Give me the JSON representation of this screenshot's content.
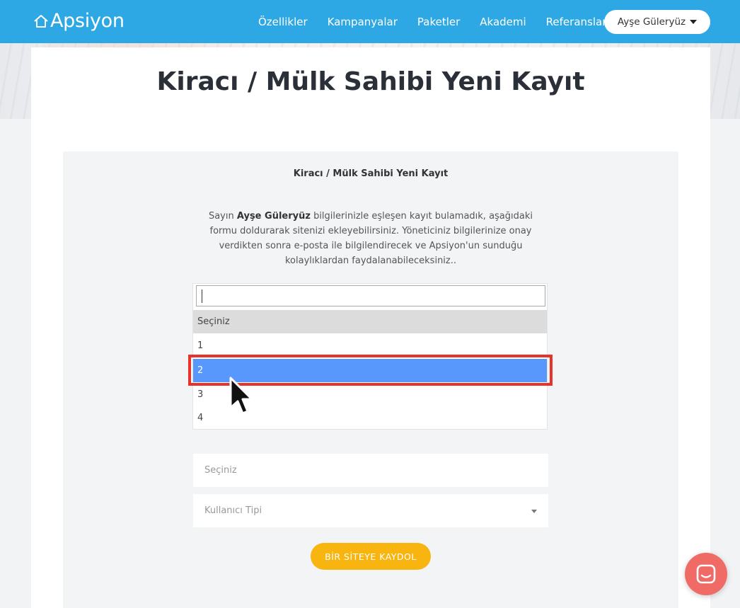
{
  "brand": {
    "name": "Apsiyon"
  },
  "nav": {
    "links": [
      "Özellikler",
      "Kampanyalar",
      "Paketler",
      "Akademi",
      "Referanslar"
    ],
    "user_name": "Ayşe Güleryüz"
  },
  "page": {
    "title": "Kiracı / Mülk Sahibi Yeni Kayıt"
  },
  "form": {
    "heading": "Kiracı / Mülk Sahibi Yeni Kayıt",
    "intro_prefix": "Sayın ",
    "intro_name": "Ayşe Güleryüz",
    "intro_suffix": " bilgilerinizle eşleşen kayıt bulamadık, aşağıdaki formu doldurarak sitenizi ekleyebilirsiniz. Yöneticiniz bilgilerinize onay verdikten sonra e-posta ile bilgilendirecek ve Apsiyon'un sunduğu kolaylıklardan faydalanabileceksiniz..",
    "dropdown": {
      "search_value": "",
      "header": "Seçiniz",
      "options": [
        "1",
        "2",
        "3",
        "4"
      ],
      "highlighted": "2"
    },
    "field_secondary_placeholder": "Seçiniz",
    "user_type_placeholder": "Kullanıcı Tipi",
    "submit_label": "BİR SİTEYE KAYDOL"
  },
  "colors": {
    "navbar": "#2ea8e5",
    "highlight_option": "#5897fb",
    "annotation_box": "#e8332a",
    "submit": "#f8b40f",
    "chat": "#f06b66"
  }
}
